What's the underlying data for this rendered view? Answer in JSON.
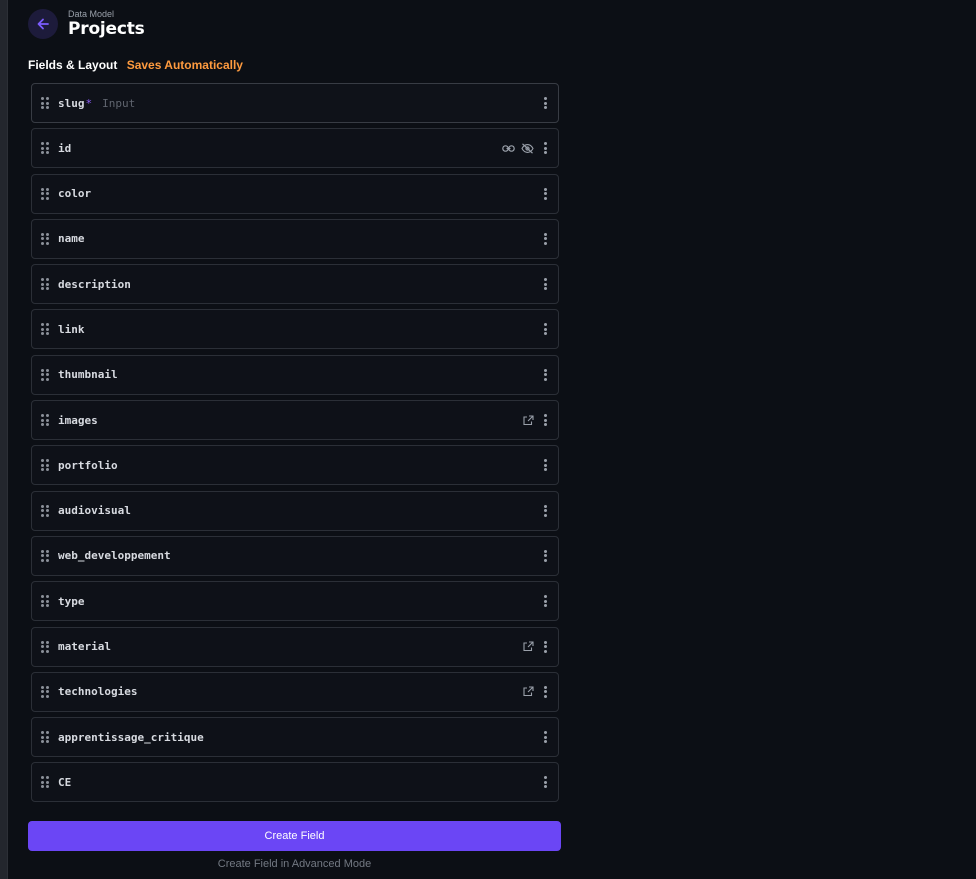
{
  "header": {
    "breadcrumb": "Data Model",
    "title": "Projects",
    "back_icon": "arrow-left-icon"
  },
  "section": {
    "label": "Fields & Layout",
    "status": "Saves Automatically"
  },
  "colors": {
    "accent": "#6b46f5",
    "status": "#ff9b3f",
    "required": "#8b5cf6"
  },
  "fields": [
    {
      "name": "slug",
      "required_mark": "*",
      "hint": "Input",
      "icons": []
    },
    {
      "name": "id",
      "icons": [
        "link-icon",
        "eye-off-icon"
      ]
    },
    {
      "name": "color",
      "icons": []
    },
    {
      "name": "name",
      "icons": []
    },
    {
      "name": "description",
      "icons": []
    },
    {
      "name": "link",
      "icons": []
    },
    {
      "name": "thumbnail",
      "icons": []
    },
    {
      "name": "images",
      "icons": [
        "open-external-icon"
      ]
    },
    {
      "name": "portfolio",
      "icons": []
    },
    {
      "name": "audiovisual",
      "icons": []
    },
    {
      "name": "web_developpement",
      "icons": []
    },
    {
      "name": "type",
      "icons": []
    },
    {
      "name": "material",
      "icons": [
        "open-external-icon"
      ]
    },
    {
      "name": "technologies",
      "icons": [
        "open-external-icon"
      ]
    },
    {
      "name": "apprentissage_critique",
      "icons": []
    },
    {
      "name": "CE",
      "icons": []
    }
  ],
  "actions": {
    "create_label": "Create Field",
    "advanced_label": "Create Field in Advanced Mode"
  }
}
